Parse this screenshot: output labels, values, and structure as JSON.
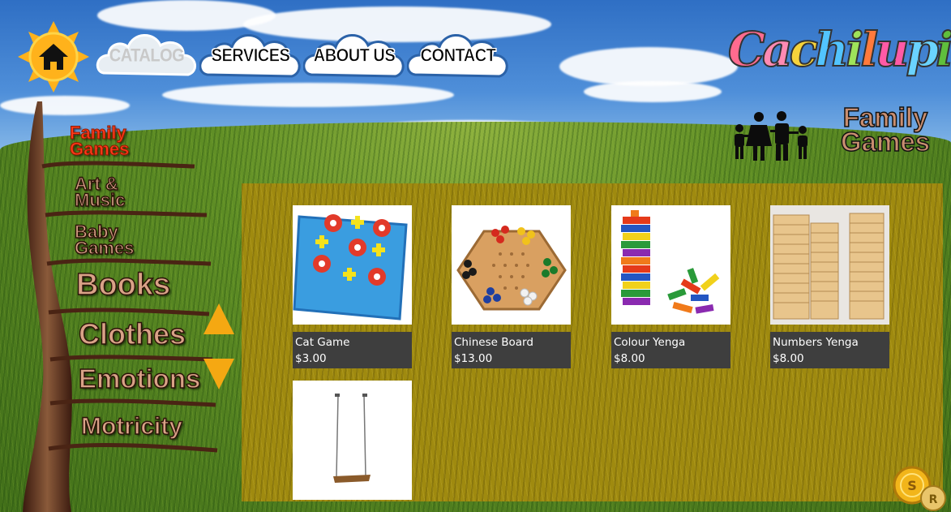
{
  "nav": {
    "home_icon": "home-icon",
    "items": [
      {
        "label": "CATALOG",
        "active": false
      },
      {
        "label": "SERVICES",
        "active": true
      },
      {
        "label": "ABOUT US",
        "active": true
      },
      {
        "label": "CONTACT",
        "active": true
      }
    ]
  },
  "logo": {
    "letters": [
      "C",
      "a",
      "c",
      "h",
      "i",
      "l",
      "u",
      "p",
      "i"
    ],
    "colors": [
      "#ff6b8f",
      "#ff8ab3",
      "#f6d33b",
      "#52c4ff",
      "#9ee35a",
      "#ff7a3c",
      "#ff5aa6",
      "#6ad3ff",
      "#5fbf3c"
    ]
  },
  "header": {
    "family_icon": "family-icon",
    "title": "Family\nGames"
  },
  "sidebar": {
    "items": [
      {
        "label": "Family\nGames",
        "active": true
      },
      {
        "label": "Art &\nMusic",
        "active": false
      },
      {
        "label": "Baby\nGames",
        "active": false
      },
      {
        "label": "Books",
        "active": false
      },
      {
        "label": "Clothes",
        "active": false
      },
      {
        "label": "Emotions",
        "active": false
      },
      {
        "label": "Motricity",
        "active": false
      }
    ],
    "scroll_up_icon": "arrow-up-icon",
    "scroll_down_icon": "arrow-down-icon"
  },
  "products": [
    {
      "name": "Cat Game",
      "price": "$3.00",
      "image": "tic-tac-toe-board-image"
    },
    {
      "name": "Chinese Board",
      "price": "$13.00",
      "image": "chinese-checkers-image"
    },
    {
      "name": "Colour Yenga",
      "price": "$8.00",
      "image": "colour-block-tower-image"
    },
    {
      "name": "Numbers Yenga",
      "price": "$8.00",
      "image": "numbered-block-tower-image"
    },
    {
      "name": "",
      "price": "",
      "image": "swing-image"
    }
  ],
  "footer": {
    "coin_icon": "coin-icon"
  }
}
